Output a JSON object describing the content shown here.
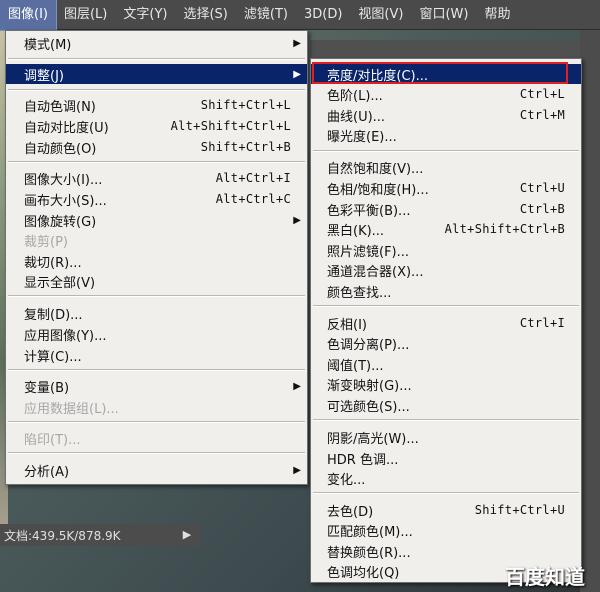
{
  "menubar": {
    "items": [
      {
        "label": "图像(I)",
        "active": true
      },
      {
        "label": "图层(L)"
      },
      {
        "label": "文字(Y)"
      },
      {
        "label": "选择(S)"
      },
      {
        "label": "滤镜(T)"
      },
      {
        "label": "3D(D)"
      },
      {
        "label": "视图(V)"
      },
      {
        "label": "窗口(W)"
      },
      {
        "label": "帮助"
      }
    ]
  },
  "image_menu": {
    "mode": "模式(M)",
    "adjustments": "调整(J)",
    "auto_tone": {
      "label": "自动色调(N)",
      "shortcut": "Shift+Ctrl+L"
    },
    "auto_contrast": {
      "label": "自动对比度(U)",
      "shortcut": "Alt+Shift+Ctrl+L"
    },
    "auto_color": {
      "label": "自动颜色(O)",
      "shortcut": "Shift+Ctrl+B"
    },
    "image_size": {
      "label": "图像大小(I)...",
      "shortcut": "Alt+Ctrl+I"
    },
    "canvas_size": {
      "label": "画布大小(S)...",
      "shortcut": "Alt+Ctrl+C"
    },
    "image_rotation": "图像旋转(G)",
    "crop": "裁剪(P)",
    "trim": "裁切(R)...",
    "reveal_all": "显示全部(V)",
    "duplicate": "复制(D)...",
    "apply_image": "应用图像(Y)...",
    "calculations": "计算(C)...",
    "variables": "变量(B)",
    "apply_data_set": "应用数据组(L)...",
    "trap": "陷印(T)...",
    "analysis": "分析(A)"
  },
  "adjust_menu": {
    "brightness_contrast": "亮度/对比度(C)...",
    "levels": {
      "label": "色阶(L)...",
      "shortcut": "Ctrl+L"
    },
    "curves": {
      "label": "曲线(U)...",
      "shortcut": "Ctrl+M"
    },
    "exposure": "曝光度(E)...",
    "vibrance": "自然饱和度(V)...",
    "hue_saturation": {
      "label": "色相/饱和度(H)...",
      "shortcut": "Ctrl+U"
    },
    "color_balance": {
      "label": "色彩平衡(B)...",
      "shortcut": "Ctrl+B"
    },
    "black_white": {
      "label": "黑白(K)...",
      "shortcut": "Alt+Shift+Ctrl+B"
    },
    "photo_filter": "照片滤镜(F)...",
    "channel_mixer": "通道混合器(X)...",
    "color_lookup": "颜色查找...",
    "invert": {
      "label": "反相(I)",
      "shortcut": "Ctrl+I"
    },
    "posterize": "色调分离(P)...",
    "threshold": "阈值(T)...",
    "gradient_map": "渐变映射(G)...",
    "selective_color": "可选颜色(S)...",
    "shadows_highlights": "阴影/高光(W)...",
    "hdr_toning": "HDR 色调...",
    "variations": "变化...",
    "desaturate": {
      "label": "去色(D)",
      "shortcut": "Shift+Ctrl+U"
    },
    "match_color": "匹配颜色(M)...",
    "replace_color": "替换颜色(R)...",
    "equalize": "色调均化(Q)"
  },
  "status": {
    "doc_info": "文档:439.5K/878.9K"
  },
  "watermark": "百度知道",
  "colors": {
    "menu_bg": "#f0efeb",
    "selection": "#0a246a",
    "highlight_box": "#e02020",
    "disabled_text": "#a7a7a7"
  }
}
